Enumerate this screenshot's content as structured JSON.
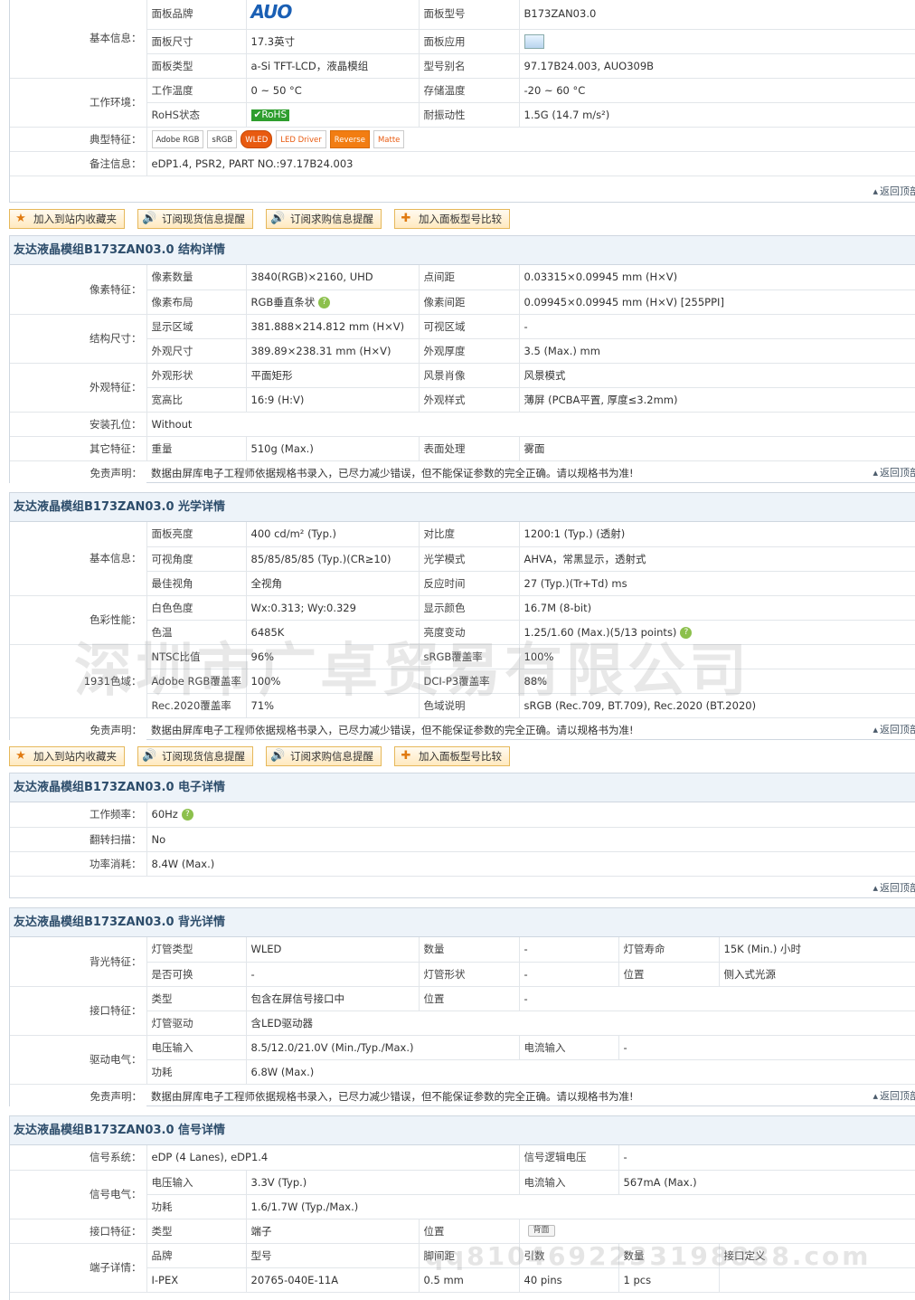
{
  "summary": {
    "groups": {
      "basic": "基本信息：",
      "env": "工作环境：",
      "feature": "典型特征：",
      "remark": "备注信息："
    },
    "brand_label": "面板品牌",
    "brand_logo": "AUO",
    "model_label": "面板型号",
    "model": "B173ZAN03.0",
    "size_label": "面板尺寸",
    "size": "17.3英寸",
    "app_label": "面板应用",
    "type_label": "面板类型",
    "type": "a-Si TFT-LCD，液晶模组",
    "alias_label": "型号别名",
    "alias": "97.17B24.003, AUO309B",
    "temp_label": "工作温度",
    "temp": "0 ~ 50 °C",
    "store_label": "存储温度",
    "store": "-20 ~ 60 °C",
    "rohs_label": "RoHS状态",
    "rohs": "RoHS",
    "vib_label": "耐振动性",
    "vib": "1.5G (14.7 m/s²)",
    "badges": [
      "Adobe RGB",
      "sRGB",
      "WLED",
      "LED Driver",
      "Reverse",
      "Matte"
    ],
    "remark": "eDP1.4, PSR2, PART NO.:97.17B24.003",
    "back": "返回顶部"
  },
  "buttons": [
    "加入到站内收藏夹",
    "订阅现货信息提醒",
    "订阅求购信息提醒",
    "加入面板型号比较"
  ],
  "disclaimer": {
    "label": "免责声明：",
    "text": "数据由屏库电子工程师依据规格书录入，已尽力减少错误，但不能保证参数的完全正确。请以规格书为准!"
  },
  "structure": {
    "title": "友达液晶模组B173ZAN03.0 结构详情",
    "g_pixel": "像素特征：",
    "g_size": "结构尺寸：",
    "g_look": "外观特征：",
    "g_mount": "安装孔位：",
    "g_other": "其它特征：",
    "r1": [
      "像素数量",
      "3840(RGB)×2160, UHD",
      "点间距",
      "0.03315×0.09945 mm (H×V)"
    ],
    "r2": [
      "像素布局",
      "RGB垂直条状",
      "像素间距",
      "0.09945×0.09945 mm (H×V)  [255PPI]"
    ],
    "r3": [
      "显示区域",
      "381.888×214.812 mm (H×V)",
      "可视区域",
      "-"
    ],
    "r4": [
      "外观尺寸",
      "389.89×238.31 mm (H×V)",
      "外观厚度",
      "3.5 (Max.) mm"
    ],
    "r5": [
      "外观形状",
      "平面矩形",
      "风景肖像",
      "风景模式"
    ],
    "r6": [
      "宽高比",
      "16:9 (H:V)",
      "外观样式",
      "薄屏 (PCBA平置, 厚度≤3.2mm)"
    ],
    "mount": "Without",
    "r7": [
      "重量",
      "510g (Max.)",
      "表面处理",
      "雾面"
    ]
  },
  "optical": {
    "title": "友达液晶模组B173ZAN03.0 光学详情",
    "g_basic": "基本信息：",
    "g_color": "色彩性能：",
    "g_gamut": "1931色域：",
    "r1": [
      "面板亮度",
      "400 cd/m² (Typ.)",
      "对比度",
      "1200:1 (Typ.) (透射)"
    ],
    "r2": [
      "可视角度",
      "85/85/85/85 (Typ.)(CR≥10)",
      "光学模式",
      "AHVA，常黑显示，透射式"
    ],
    "r3": [
      "最佳视角",
      "全视角",
      "反应时间",
      "27 (Typ.)(Tr+Td) ms"
    ],
    "r4": [
      "白色色度",
      "Wx:0.313; Wy:0.329",
      "显示颜色",
      "16.7M (8-bit)"
    ],
    "r5": [
      "色温",
      "6485K",
      "亮度变动",
      "1.25/1.60 (Max.)(5/13 points)"
    ],
    "r6": [
      "NTSC比值",
      "96%",
      "sRGB覆盖率",
      "100%"
    ],
    "r7": [
      "Adobe RGB覆盖率",
      "100%",
      "DCI-P3覆盖率",
      "88%"
    ],
    "r8": [
      "Rec.2020覆盖率",
      "71%",
      "色域说明",
      "sRGB (Rec.709, BT.709), Rec.2020 (BT.2020)"
    ]
  },
  "electronic": {
    "title": "友达液晶模组B173ZAN03.0 电子详情",
    "g_freq": "工作频率：",
    "freq": "60Hz",
    "g_flip": "翻转扫描：",
    "flip": "No",
    "g_power": "功率消耗：",
    "power": "8.4W (Max.)"
  },
  "backlight": {
    "title": "友达液晶模组B173ZAN03.0 背光详情",
    "g_bl": "背光特征：",
    "g_if": "接口特征：",
    "g_drv": "驱动电气：",
    "r1": [
      "灯管类型",
      "WLED",
      "数量",
      "-",
      "灯管寿命",
      "15K (Min.) 小时"
    ],
    "r2": [
      "是否可换",
      "-",
      "灯管形状",
      "-",
      "位置",
      "侧入式光源"
    ],
    "r3": [
      "类型",
      "包含在屏信号接口中",
      "位置",
      "-"
    ],
    "r4": [
      "灯管驱动",
      "含LED驱动器"
    ],
    "r5": [
      "电压输入",
      "8.5/12.0/21.0V (Min./Typ./Max.)",
      "电流输入",
      "-"
    ],
    "r6": [
      "功耗",
      "6.8W (Max.)"
    ]
  },
  "signal": {
    "title": "友达液晶模组B173ZAN03.0 信号详情",
    "g_sys": "信号系统：",
    "g_elec": "信号电气：",
    "g_if": "接口特征：",
    "g_term": "端子详情：",
    "sys": "eDP (4 Lanes), eDP1.4",
    "logic_label": "信号逻辑电压",
    "logic": "-",
    "r1": [
      "电压输入",
      "3.3V (Typ.)",
      "电流输入",
      "567mA (Max.)"
    ],
    "r2": [
      "功耗",
      "1.6/1.7W (Typ./Max.)"
    ],
    "r3": [
      "类型",
      "端子",
      "位置",
      "背面"
    ],
    "head": [
      "品牌",
      "型号",
      "脚间距",
      "引数",
      "数量",
      "接口定义"
    ],
    "row": [
      "I-PEX",
      "20765-040E-11A",
      "0.5 mm",
      "40 pins",
      "1 pcs"
    ]
  },
  "watermark": {
    "text": "深圳市广卓贸易有限公司",
    "qq": "qq8104692233198888.com"
  }
}
